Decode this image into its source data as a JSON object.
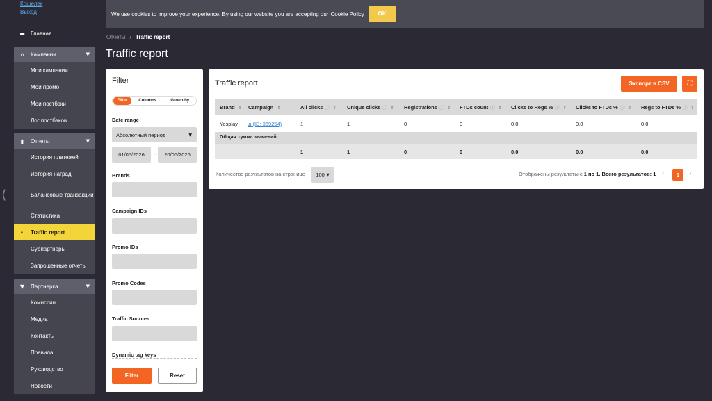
{
  "sidebar": {
    "top_links": [
      "Кошелек",
      "Выход"
    ],
    "home": "Главная",
    "groups": {
      "campaigns": {
        "label": "Кампании",
        "items": [
          "Мои кампании",
          "Мои промо",
          "Мои постбэки",
          "Лог постбэков"
        ]
      },
      "reports": {
        "label": "Отчеты",
        "items": [
          "История платежей",
          "История наград",
          "Балансовые транзакции",
          "Статистика",
          "Traffic report",
          "Субпартнеры",
          "Запрошенные отчеты"
        ]
      },
      "partner": {
        "label": "Партнерка",
        "items": [
          "Комиссии",
          "Медиа",
          "Контакты",
          "Правила",
          "Руководство",
          "Новости"
        ]
      }
    }
  },
  "cookie": {
    "text": "We use cookies to improve your experience. By using our website you are accepting our",
    "link": "Cookie Policy",
    "ok": "OK"
  },
  "breadcrumb": {
    "parent": "Отчеты",
    "sep": "/",
    "current": "Traffic report"
  },
  "page_title": "Traffic report",
  "filter": {
    "title": "Filter",
    "tabs": [
      "Filter",
      "Columns",
      "Group by"
    ],
    "date_range_label": "Date range",
    "date_range_value": "Абсолютный период",
    "date_from": "01/05/2026",
    "date_to": "20/05/2026",
    "dash": "–",
    "fields": [
      "Brands",
      "Campaign IDs",
      "Promo IDs",
      "Promo Codes",
      "Traffic Sources",
      "Dynamic tag keys"
    ],
    "btn_filter": "Filter",
    "btn_reset": "Reset"
  },
  "report": {
    "title": "Traffic report",
    "export_csv": "Экспорт в CSV",
    "columns": [
      "Brand",
      "Campaign",
      "All clicks",
      "Unique clicks",
      "Registrations",
      "FTDs count",
      "Clicks to Regs %",
      "Clicks to FTDs %",
      "Regs to FTDs %"
    ],
    "row": {
      "brand": "Yesplay",
      "campaign": "д (ID: 369254)",
      "all_clicks": "1",
      "unique_clicks": "1",
      "registrations": "0",
      "ftds": "0",
      "c2r": "0.0",
      "c2f": "0.0",
      "r2f": "0.0"
    },
    "total_label": "Общая сумма значений",
    "total": {
      "all_clicks": "1",
      "unique_clicks": "1",
      "registrations": "0",
      "ftds": "0",
      "c2r": "0.0",
      "c2f": "0.0",
      "r2f": "0.0"
    },
    "per_page_label": "Количество результатов на странице",
    "per_page_value": "100",
    "results_text": "Отображены результаты с",
    "results_bold": "1 по 1. Всего результатов: 1",
    "current_page": "1"
  },
  "colors": {
    "accent": "#f26522",
    "active_nav": "#f3d53a",
    "background": "#2b2a34",
    "cookie_ok": "#f2c94c"
  }
}
